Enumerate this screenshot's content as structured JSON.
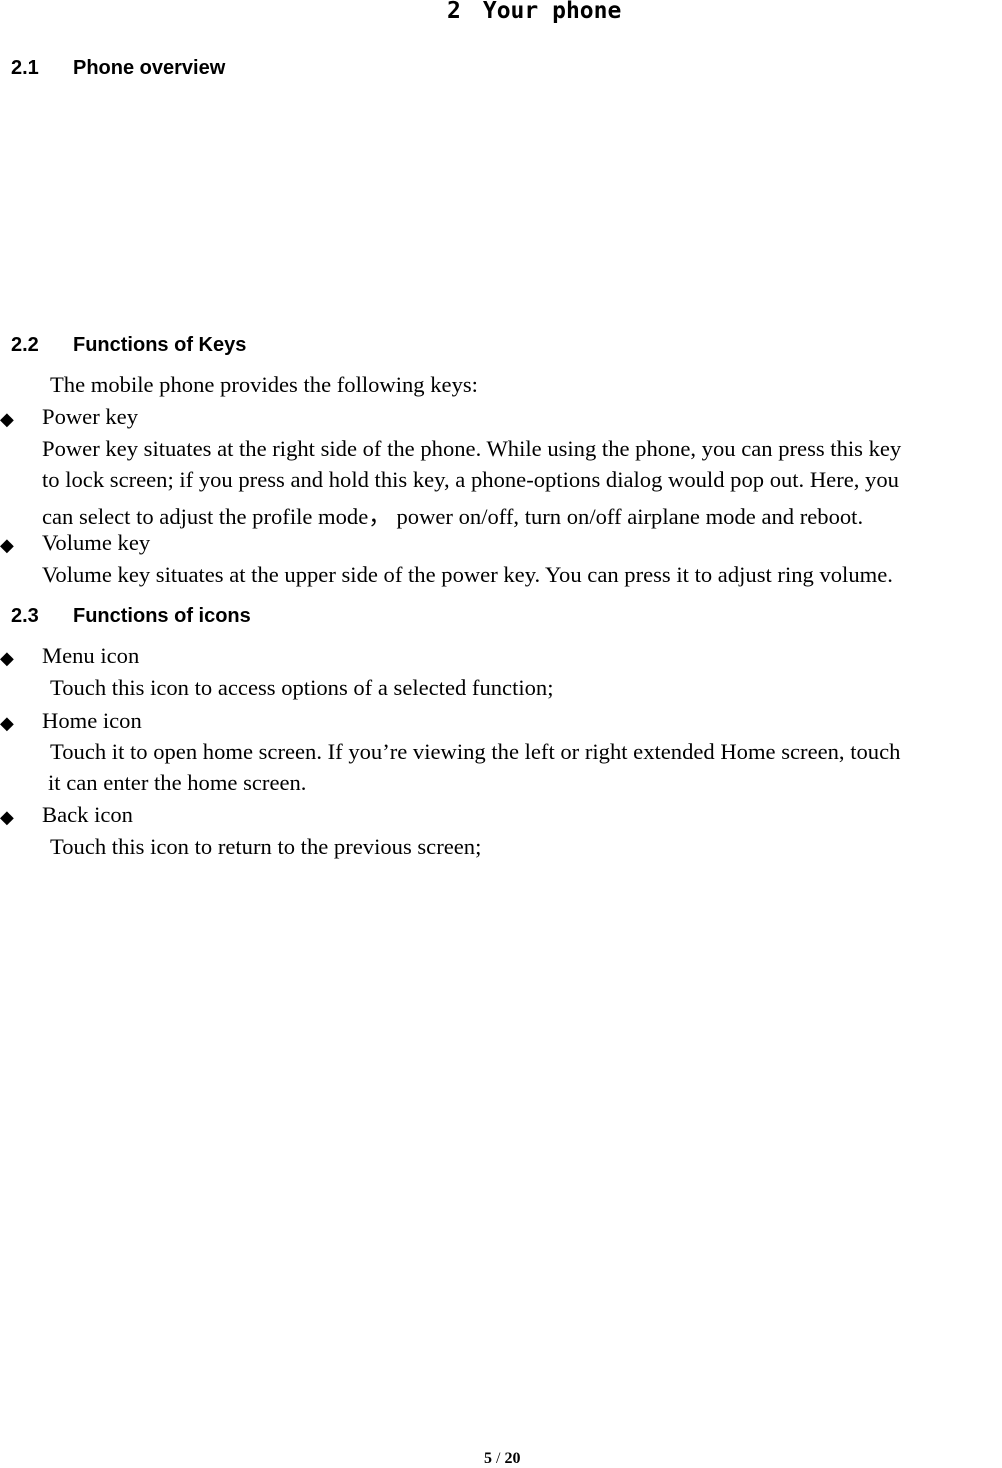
{
  "chapter": {
    "number": "2",
    "title": "Your phone"
  },
  "sections": [
    {
      "number": "2.1",
      "title": "Phone overview"
    },
    {
      "number": "2.2",
      "title": "Functions of Keys",
      "intro": "The mobile phone provides the following keys:"
    },
    {
      "number": "2.3",
      "title": "Functions of icons"
    }
  ],
  "keys": [
    {
      "name": "Power key",
      "lines": [
        "Power key situates at the right side of the phone. While using the phone, you can press this key",
        "to lock screen; if you press and hold this key, a phone-options dialog would pop out. Here, you",
        "can select to adjust the profile mode， power on/off, turn on/off airplane mode and reboot."
      ]
    },
    {
      "name": "Volume key",
      "lines": [
        "Volume key situates at the upper side of the power key. You can press it to adjust ring volume."
      ]
    }
  ],
  "icons": [
    {
      "name": "Menu icon",
      "lines": [
        "Touch this icon to access options of a selected function;"
      ]
    },
    {
      "name": "Home icon",
      "lines": [
        "Touch it to open home screen. If you’re viewing the left or right extended Home screen, touch",
        "it can enter the home screen."
      ]
    },
    {
      "name": "Back icon",
      "lines": [
        "Touch this icon to return to the previous screen;"
      ]
    }
  ],
  "bullet_glyph": "◆",
  "footer": {
    "page": "5",
    "separator": "/",
    "total": "20"
  }
}
